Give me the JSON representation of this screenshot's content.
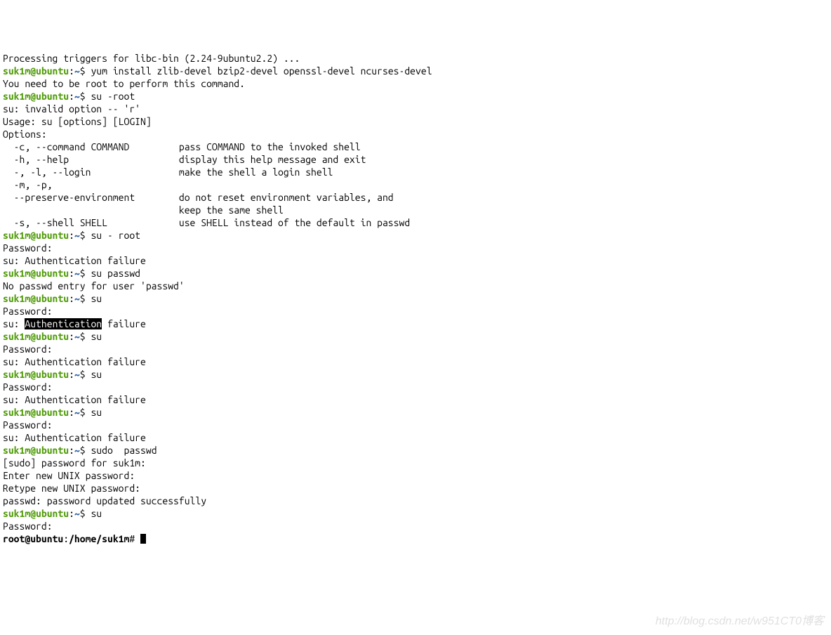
{
  "prompt": {
    "user": "suk1m@ubuntu",
    "path": "~",
    "sep": ":",
    "sym": "$"
  },
  "root_prompt": {
    "user": "root@ubuntu",
    "path": "/home/suk1m",
    "sep": ":",
    "sym": "#"
  },
  "lines": {
    "l0": "Processing triggers for libc-bin (2.24-9ubuntu2.2) ...",
    "cmd1": " yum install zlib-devel bzip2-devel openssl-devel ncurses-devel",
    "l2": "You need to be root to perform this command.",
    "cmd2": " su -root",
    "l4": "su: invalid option -- 'r'",
    "l5": "Usage: su [options] [LOGIN]",
    "l6": "",
    "l7": "Options:",
    "l8": "  -c, --command COMMAND         pass COMMAND to the invoked shell",
    "l9": "  -h, --help                    display this help message and exit",
    "l10": "  -, -l, --login                make the shell a login shell",
    "l11": "  -m, -p,",
    "l12": "  --preserve-environment        do not reset environment variables, and",
    "l13": "                                keep the same shell",
    "l14": "  -s, --shell SHELL             use SHELL instead of the default in passwd",
    "l15": "",
    "cmd3": " su - root",
    "l17": "Password:",
    "l18": "su: Authentication failure",
    "cmd4": " su passwd",
    "l20": "No passwd entry for user 'passwd'",
    "cmd5": " su",
    "l22": "Password:",
    "l23a": "su: ",
    "l23b": "Authentication",
    "l23c": " failure",
    "cmd6": " su",
    "l25": "Password:",
    "l26": "su: Authentication failure",
    "cmd7": " su",
    "l28": "Password:",
    "l29": "su: Authentication failure",
    "cmd8": " su",
    "l31": "Password:",
    "l32": "su: Authentication failure",
    "cmd9": " sudo  passwd",
    "l34": "[sudo] password for suk1m:",
    "l35": "Enter new UNIX password:",
    "l36": "Retype new UNIX password:",
    "l37": "passwd: password updated successfully",
    "cmd10": " su",
    "l39": "Password:",
    "root_after": " "
  },
  "watermark": "http://blog.csdn.net/w951CT0博客"
}
